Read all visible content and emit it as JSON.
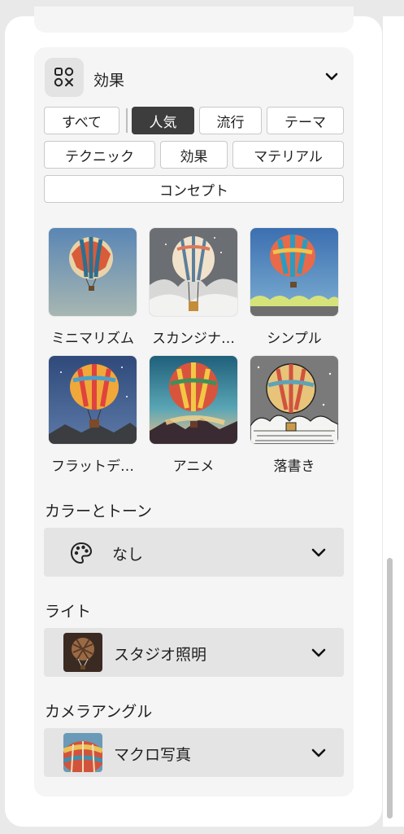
{
  "effects": {
    "title": "効果",
    "icon": "effects-grid-icon",
    "filters": [
      "すべて",
      "人気",
      "流行",
      "テーマ",
      "テクニック",
      "効果",
      "マテリアル",
      "コンセプト"
    ],
    "active_filter": "人気",
    "styles": [
      {
        "label": "ミニマリズム"
      },
      {
        "label": "スカンジナ…"
      },
      {
        "label": "シンプル"
      },
      {
        "label": "フラットデ…"
      },
      {
        "label": "アニメ"
      },
      {
        "label": "落書き"
      }
    ]
  },
  "color_tone": {
    "title": "カラーとトーン",
    "value": "なし",
    "icon": "palette-icon"
  },
  "light": {
    "title": "ライト",
    "value": "スタジオ照明"
  },
  "camera_angle": {
    "title": "カメラアングル",
    "value": "マクロ写真"
  },
  "colors": {
    "card_bg": "#f5f5f5",
    "dropdown_bg": "#e4e4e4",
    "active_chip": "#3d3d3d"
  }
}
